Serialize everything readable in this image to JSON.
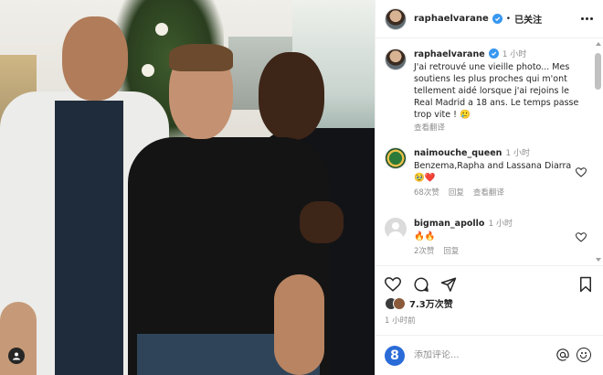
{
  "header": {
    "username": "raphaelvarane",
    "separator": "•",
    "follow_label": "已关注"
  },
  "caption": {
    "username": "raphaelvarane",
    "time": "1 小时",
    "text": "J'ai retrouvé une vieille photo... Mes soutiens les plus proches qui m'ont tellement aidé lorsque j'ai rejoins le Real Madrid a 18 ans. Le temps passe trop vite ! 🥲",
    "translate_label": "查看翻译"
  },
  "comments": [
    {
      "username": "naimouche_queen",
      "time": "1 小时",
      "text": "Benzema,Rapha and Lassana Diarra🥹❤️",
      "likes": "68次赞",
      "reply": "回复",
      "translate": "查看翻译"
    },
    {
      "username": "bigman_apollo",
      "time": "1 小时",
      "text": "🔥🔥",
      "likes": "2次赞",
      "reply": "回复"
    }
  ],
  "post": {
    "likes": "7.3万次赞",
    "time": "1 小时前"
  },
  "comment_box": {
    "placeholder": "添加评论...",
    "logo_text": "8"
  },
  "colors": {
    "verified": "#3897f0",
    "muted": "#8e8e8e",
    "text": "#262626",
    "logo": "#2a6bd8"
  },
  "icons": [
    "verified-icon",
    "more-icon",
    "heart-icon",
    "comment-icon",
    "share-icon",
    "bookmark-icon",
    "emoji-icon",
    "photo-tag-icon"
  ]
}
